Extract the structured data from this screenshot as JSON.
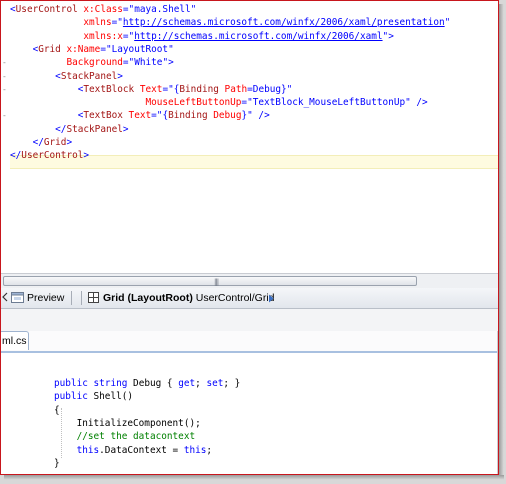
{
  "xaml": {
    "lines": [
      [
        [
          "<",
          "b"
        ],
        [
          "UserControl",
          "m"
        ],
        [
          " x:Class",
          "r"
        ],
        [
          "=\"",
          "b"
        ],
        [
          "maya.Shell",
          "b"
        ],
        [
          "\"",
          "b"
        ]
      ],
      [
        [
          "             ",
          ""
        ],
        [
          "xmlns",
          "r"
        ],
        [
          "=\"",
          "b"
        ],
        [
          "http://schemas.microsoft.com/winfx/2006/xaml/presentation",
          "u"
        ],
        [
          "\"",
          "b"
        ]
      ],
      [
        [
          "             ",
          ""
        ],
        [
          "xmlns:x",
          "r"
        ],
        [
          "=\"",
          "b"
        ],
        [
          "http://schemas.microsoft.com/winfx/2006/xaml",
          "u"
        ],
        [
          "\">",
          "b"
        ]
      ],
      [
        [
          "    ",
          ""
        ],
        [
          "<",
          "b"
        ],
        [
          "Grid",
          "m"
        ],
        [
          " x:Name",
          "r"
        ],
        [
          "=\"",
          "b"
        ],
        [
          "LayoutRoot",
          "b"
        ],
        [
          "\"",
          "b"
        ]
      ],
      [
        [
          "          ",
          ""
        ],
        [
          "Background",
          "r"
        ],
        [
          "=\"",
          "b"
        ],
        [
          "White",
          "b"
        ],
        [
          "\">",
          "b"
        ]
      ],
      [
        [
          "        ",
          ""
        ],
        [
          "<",
          "b"
        ],
        [
          "StackPanel",
          "m"
        ],
        [
          ">",
          "b"
        ]
      ],
      [
        [
          "            ",
          ""
        ],
        [
          "<",
          "b"
        ],
        [
          "TextBlock",
          "m"
        ],
        [
          " Text",
          "r"
        ],
        [
          "=\"",
          "b"
        ],
        [
          "{",
          "b"
        ],
        [
          "Binding",
          "m"
        ],
        [
          " Path",
          "r"
        ],
        [
          "=",
          "b"
        ],
        [
          "Debug",
          "b"
        ],
        [
          "}\"",
          "b"
        ]
      ],
      [
        [
          "                        ",
          ""
        ],
        [
          "MouseLeftButtonUp",
          "r"
        ],
        [
          "=\"",
          "b"
        ],
        [
          "TextBlock_MouseLeftButtonUp",
          "b"
        ],
        [
          "\" />",
          "b"
        ]
      ],
      [
        [
          "            ",
          ""
        ],
        [
          "<",
          "b"
        ],
        [
          "TextBox",
          "m"
        ],
        [
          " Text",
          "r"
        ],
        [
          "=\"",
          "b"
        ],
        [
          "{",
          "b"
        ],
        [
          "Binding",
          "m"
        ],
        [
          " Debug",
          "r"
        ],
        [
          "}\"",
          "b"
        ],
        [
          " />",
          "b"
        ]
      ],
      [
        [
          "        ",
          ""
        ],
        [
          "</",
          "b"
        ],
        [
          "StackPanel",
          "m"
        ],
        [
          ">",
          "b"
        ]
      ],
      [
        [
          "    ",
          ""
        ],
        [
          "</",
          "b"
        ],
        [
          "Grid",
          "m"
        ],
        [
          ">",
          "b"
        ]
      ],
      [
        [
          "</",
          "b"
        ],
        [
          "UserControl",
          "m"
        ],
        [
          ">",
          "b"
        ]
      ]
    ]
  },
  "split_bar": {
    "preview_label": "Preview",
    "breadcrumb_bold": "Grid (LayoutRoot)",
    "breadcrumb_rest": "UserControl/Grid"
  },
  "tab": {
    "label": "ml.cs"
  },
  "csharp": {
    "lines": [
      [
        [
          "public",
          "k"
        ],
        [
          " ",
          ""
        ],
        [
          "string",
          "k"
        ],
        [
          " Debug { ",
          ""
        ],
        [
          "get",
          "k"
        ],
        [
          "; ",
          ""
        ],
        [
          "set",
          "k"
        ],
        [
          "; }",
          ""
        ]
      ],
      [
        [
          "public",
          "k"
        ],
        [
          " Shell()",
          ""
        ]
      ],
      [
        [
          "{",
          ""
        ]
      ],
      [
        [
          "    InitializeComponent();",
          ""
        ]
      ],
      [
        [
          "    ",
          ""
        ],
        [
          "//set the datacontext",
          "g"
        ]
      ],
      [
        [
          "    ",
          ""
        ],
        [
          "this",
          "k"
        ],
        [
          ".DataContext = ",
          ""
        ],
        [
          "this",
          "k"
        ],
        [
          ";",
          ""
        ]
      ],
      [
        [
          "}",
          ""
        ]
      ]
    ]
  }
}
